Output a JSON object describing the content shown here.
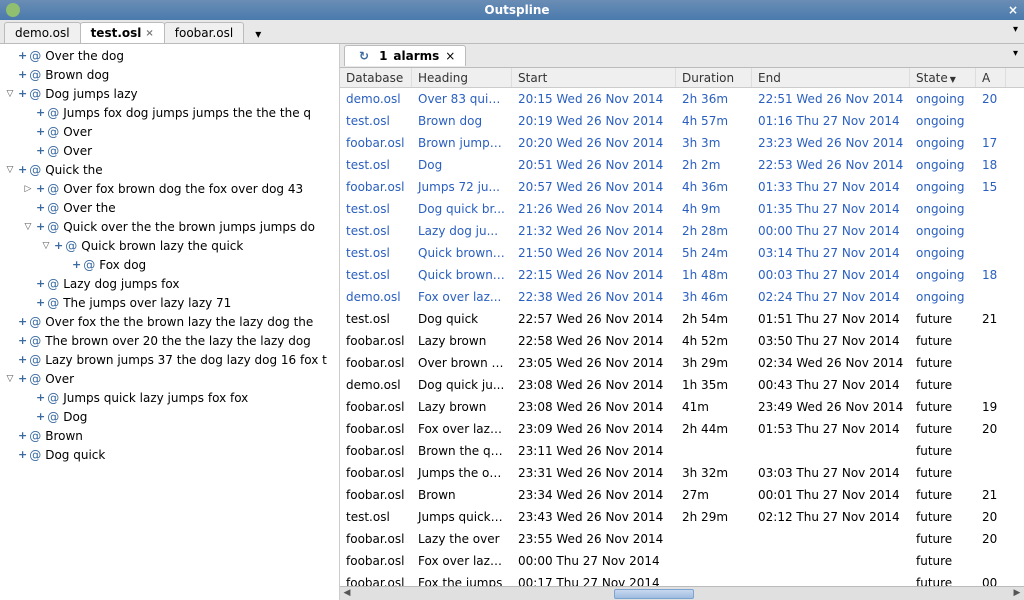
{
  "window": {
    "title": "Outspline"
  },
  "file_tabs": [
    {
      "label": "demo.osl",
      "active": false,
      "closable": false
    },
    {
      "label": "test.osl",
      "active": true,
      "closable": true
    },
    {
      "label": "foobar.osl",
      "active": false,
      "closable": false
    }
  ],
  "alarm_tab": {
    "icon": "↻",
    "count": "1",
    "label": "alarms"
  },
  "tree": [
    {
      "depth": 0,
      "expander": "",
      "label": "Over the dog"
    },
    {
      "depth": 0,
      "expander": "",
      "label": "Brown dog"
    },
    {
      "depth": 0,
      "expander": "▽",
      "label": "Dog jumps lazy"
    },
    {
      "depth": 1,
      "expander": "",
      "label": "Jumps fox dog jumps jumps the the the q"
    },
    {
      "depth": 1,
      "expander": "",
      "label": "Over"
    },
    {
      "depth": 1,
      "expander": "",
      "label": "Over"
    },
    {
      "depth": 0,
      "expander": "▽",
      "label": "Quick the"
    },
    {
      "depth": 1,
      "expander": "▷",
      "label": "Over fox brown dog the fox over dog 43"
    },
    {
      "depth": 1,
      "expander": "",
      "label": "Over the"
    },
    {
      "depth": 1,
      "expander": "▽",
      "label": "Quick over the the brown jumps jumps do"
    },
    {
      "depth": 2,
      "expander": "▽",
      "label": "Quick brown lazy the quick"
    },
    {
      "depth": 3,
      "expander": "",
      "label": "Fox dog"
    },
    {
      "depth": 1,
      "expander": "",
      "label": "Lazy dog jumps fox"
    },
    {
      "depth": 1,
      "expander": "",
      "label": "The jumps over lazy lazy 71"
    },
    {
      "depth": 0,
      "expander": "",
      "label": "Over fox the the brown lazy the lazy dog the"
    },
    {
      "depth": 0,
      "expander": "",
      "label": "The brown over 20 the the lazy the lazy dog"
    },
    {
      "depth": 0,
      "expander": "",
      "label": "Lazy brown jumps 37 the dog lazy dog 16 fox t"
    },
    {
      "depth": 0,
      "expander": "▽",
      "label": "Over"
    },
    {
      "depth": 1,
      "expander": "",
      "label": "Jumps quick lazy jumps fox fox"
    },
    {
      "depth": 1,
      "expander": "",
      "label": "Dog"
    },
    {
      "depth": 0,
      "expander": "",
      "label": "Brown"
    },
    {
      "depth": 0,
      "expander": "",
      "label": "Dog quick"
    }
  ],
  "columns": {
    "database": "Database",
    "heading": "Heading",
    "start": "Start",
    "duration": "Duration",
    "end": "End",
    "state": "State",
    "a": "A"
  },
  "rows": [
    {
      "db": "demo.osl",
      "heading": "Over 83 quic...",
      "start": "20:15 Wed 26 Nov 2014",
      "dur": "2h 36m",
      "end": "22:51 Wed 26 Nov 2014",
      "state": "ongoing",
      "a": "20"
    },
    {
      "db": "test.osl",
      "heading": "Brown dog",
      "start": "20:19 Wed 26 Nov 2014",
      "dur": "4h 57m",
      "end": "01:16 Thu 27 Nov 2014",
      "state": "ongoing",
      "a": ""
    },
    {
      "db": "foobar.osl",
      "heading": "Brown jumps...",
      "start": "20:20 Wed 26 Nov 2014",
      "dur": "3h 3m",
      "end": "23:23 Wed 26 Nov 2014",
      "state": "ongoing",
      "a": "17"
    },
    {
      "db": "test.osl",
      "heading": "Dog",
      "start": "20:51 Wed 26 Nov 2014",
      "dur": "2h 2m",
      "end": "22:53 Wed 26 Nov 2014",
      "state": "ongoing",
      "a": "18"
    },
    {
      "db": "foobar.osl",
      "heading": "Jumps 72 ju...",
      "start": "20:57 Wed 26 Nov 2014",
      "dur": "4h 36m",
      "end": "01:33 Thu 27 Nov 2014",
      "state": "ongoing",
      "a": "15"
    },
    {
      "db": "test.osl",
      "heading": "Dog quick br...",
      "start": "21:26 Wed 26 Nov 2014",
      "dur": "4h 9m",
      "end": "01:35 Thu 27 Nov 2014",
      "state": "ongoing",
      "a": ""
    },
    {
      "db": "test.osl",
      "heading": "Lazy dog ju...",
      "start": "21:32 Wed 26 Nov 2014",
      "dur": "2h 28m",
      "end": "00:00 Thu 27 Nov 2014",
      "state": "ongoing",
      "a": ""
    },
    {
      "db": "test.osl",
      "heading": "Quick brown l...",
      "start": "21:50 Wed 26 Nov 2014",
      "dur": "5h 24m",
      "end": "03:14 Thu 27 Nov 2014",
      "state": "ongoing",
      "a": ""
    },
    {
      "db": "test.osl",
      "heading": "Quick brown l...",
      "start": "22:15 Wed 26 Nov 2014",
      "dur": "1h 48m",
      "end": "00:03 Thu 27 Nov 2014",
      "state": "ongoing",
      "a": "18"
    },
    {
      "db": "demo.osl",
      "heading": "Fox over laz...",
      "start": "22:38 Wed 26 Nov 2014",
      "dur": "3h 46m",
      "end": "02:24 Thu 27 Nov 2014",
      "state": "ongoing",
      "a": ""
    },
    {
      "db": "test.osl",
      "heading": "Dog quick",
      "start": "22:57 Wed 26 Nov 2014",
      "dur": "2h 54m",
      "end": "01:51 Thu 27 Nov 2014",
      "state": "future",
      "a": "21"
    },
    {
      "db": "foobar.osl",
      "heading": "Lazy brown",
      "start": "22:58 Wed 26 Nov 2014",
      "dur": "4h 52m",
      "end": "03:50 Thu 27 Nov 2014",
      "state": "future",
      "a": ""
    },
    {
      "db": "foobar.osl",
      "heading": "Over brown b...",
      "start": "23:05 Wed 26 Nov 2014",
      "dur": "3h 29m",
      "end": "02:34 Wed 26 Nov 2014",
      "state": "future",
      "a": ""
    },
    {
      "db": "demo.osl",
      "heading": "Dog quick ju...",
      "start": "23:08 Wed 26 Nov 2014",
      "dur": "1h 35m",
      "end": "00:43 Thu 27 Nov 2014",
      "state": "future",
      "a": ""
    },
    {
      "db": "foobar.osl",
      "heading": "Lazy brown",
      "start": "23:08 Wed 26 Nov 2014",
      "dur": "41m",
      "end": "23:49 Wed 26 Nov 2014",
      "state": "future",
      "a": "19"
    },
    {
      "db": "foobar.osl",
      "heading": "Fox over lazy...",
      "start": "23:09 Wed 26 Nov 2014",
      "dur": "2h 44m",
      "end": "01:53 Thu 27 Nov 2014",
      "state": "future",
      "a": "20"
    },
    {
      "db": "foobar.osl",
      "heading": "Brown the qu...",
      "start": "23:11 Wed 26 Nov 2014",
      "dur": "",
      "end": "",
      "state": "future",
      "a": ""
    },
    {
      "db": "foobar.osl",
      "heading": "Jumps the ov...",
      "start": "23:31 Wed 26 Nov 2014",
      "dur": "3h 32m",
      "end": "03:03 Thu 27 Nov 2014",
      "state": "future",
      "a": ""
    },
    {
      "db": "foobar.osl",
      "heading": "Brown",
      "start": "23:34 Wed 26 Nov 2014",
      "dur": "27m",
      "end": "00:01 Thu 27 Nov 2014",
      "state": "future",
      "a": "21"
    },
    {
      "db": "test.osl",
      "heading": "Jumps quick l...",
      "start": "23:43 Wed 26 Nov 2014",
      "dur": "2h 29m",
      "end": "02:12 Thu 27 Nov 2014",
      "state": "future",
      "a": "20"
    },
    {
      "db": "foobar.osl",
      "heading": "Lazy the over",
      "start": "23:55 Wed 26 Nov 2014",
      "dur": "",
      "end": "",
      "state": "future",
      "a": "20"
    },
    {
      "db": "foobar.osl",
      "heading": "Fox over lazy...",
      "start": "00:00 Thu 27 Nov 2014",
      "dur": "",
      "end": "",
      "state": "future",
      "a": ""
    },
    {
      "db": "foobar.osl",
      "heading": "Fox the jumps",
      "start": "00:17 Thu 27 Nov 2014",
      "dur": "",
      "end": "",
      "state": "future",
      "a": "00"
    }
  ]
}
